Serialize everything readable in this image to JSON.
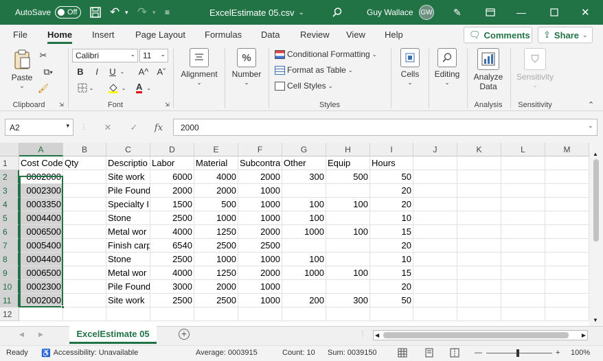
{
  "titlebar": {
    "autosave_label": "AutoSave",
    "autosave_state": "Off",
    "filename": "ExcelEstimate 05.csv",
    "user_name": "Guy Wallace",
    "user_initials": "GW"
  },
  "menu": {
    "tabs": [
      "File",
      "Home",
      "Insert",
      "Page Layout",
      "Formulas",
      "Data",
      "Review",
      "View",
      "Help"
    ],
    "comments_label": "Comments",
    "share_label": "Share"
  },
  "ribbon": {
    "clipboard": {
      "paste_label": "Paste",
      "group_label": "Clipboard"
    },
    "font": {
      "font_name": "Calibri",
      "font_size": "11",
      "bold": "B",
      "italic": "I",
      "underline": "U",
      "grow": "A^",
      "shrink": "Aˇ",
      "group_label": "Font"
    },
    "alignment_label": "Alignment",
    "number_label": "Number",
    "styles": {
      "conditional": "Conditional Formatting",
      "format_table": "Format as Table",
      "cell_styles": "Cell Styles",
      "group_label": "Styles"
    },
    "cells_label": "Cells",
    "editing_label": "Editing",
    "analysis": {
      "analyze_line1": "Analyze",
      "analyze_line2": "Data",
      "group_label": "Analysis"
    },
    "sensitivity": {
      "button_label": "Sensitivity",
      "group_label": "Sensitivity"
    }
  },
  "formula_bar": {
    "name_box": "A2",
    "fx_label": "fx",
    "value": "2000"
  },
  "grid": {
    "columns": [
      "A",
      "B",
      "C",
      "D",
      "E",
      "F",
      "G",
      "H",
      "I",
      "J",
      "K",
      "L",
      "M"
    ],
    "rows": [
      [
        "Cost Code",
        "Qty",
        "Descriptio",
        "Labor",
        "Material",
        "Subcontra",
        "Other",
        "Equip",
        "Hours",
        "",
        "",
        "",
        ""
      ],
      [
        "0002000",
        "",
        "Site work",
        "6000",
        "4000",
        "2000",
        "300",
        "500",
        "50",
        "",
        "",
        "",
        ""
      ],
      [
        "0002300",
        "",
        "Pile Found",
        "2000",
        "2000",
        "1000",
        "",
        "",
        "20",
        "",
        "",
        "",
        ""
      ],
      [
        "0003350",
        "",
        "Specialty I",
        "1500",
        "500",
        "1000",
        "100",
        "100",
        "20",
        "",
        "",
        "",
        ""
      ],
      [
        "0004400",
        "",
        "Stone",
        "2500",
        "1000",
        "1000",
        "100",
        "",
        "10",
        "",
        "",
        "",
        ""
      ],
      [
        "0006500",
        "",
        "Metal wor",
        "4000",
        "1250",
        "2000",
        "1000",
        "100",
        "15",
        "",
        "",
        "",
        ""
      ],
      [
        "0005400",
        "",
        "Finish carp",
        "6540",
        "2500",
        "2500",
        "",
        "",
        "20",
        "",
        "",
        "",
        ""
      ],
      [
        "0004400",
        "",
        "Stone",
        "2500",
        "1000",
        "1000",
        "100",
        "",
        "10",
        "",
        "",
        "",
        ""
      ],
      [
        "0006500",
        "",
        "Metal wor",
        "4000",
        "1250",
        "2000",
        "1000",
        "100",
        "15",
        "",
        "",
        "",
        ""
      ],
      [
        "0002300",
        "",
        "Pile Found",
        "3000",
        "2000",
        "1000",
        "",
        "",
        "20",
        "",
        "",
        "",
        ""
      ],
      [
        "0002000",
        "",
        "Site work",
        "2500",
        "2500",
        "1000",
        "200",
        "300",
        "50",
        "",
        "",
        "",
        ""
      ],
      [
        "",
        "",
        "",
        "",
        "",
        "",
        "",
        "",
        "",
        "",
        "",
        "",
        ""
      ]
    ]
  },
  "sheet_tab": "ExcelEstimate 05",
  "status": {
    "ready": "Ready",
    "accessibility": "Accessibility: Unavailable",
    "average": "Average: 0003915",
    "count": "Count: 10",
    "sum": "Sum: 0039150",
    "zoom": "100%"
  },
  "colors": {
    "accent": "#217346"
  }
}
